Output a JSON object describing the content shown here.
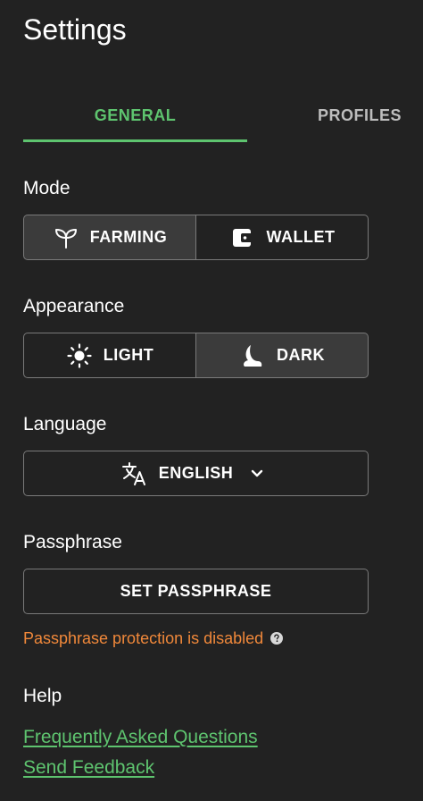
{
  "page": {
    "title": "Settings"
  },
  "tabs": [
    {
      "label": "GENERAL",
      "active": true
    },
    {
      "label": "PROFILES",
      "active": false
    }
  ],
  "mode": {
    "label": "Mode",
    "options": [
      {
        "label": "FARMING",
        "icon": "sprout-icon",
        "selected": true
      },
      {
        "label": "WALLET",
        "icon": "wallet-icon",
        "selected": false
      }
    ]
  },
  "appearance": {
    "label": "Appearance",
    "options": [
      {
        "label": "LIGHT",
        "icon": "sun-icon",
        "selected": false
      },
      {
        "label": "DARK",
        "icon": "moon-icon",
        "selected": true
      }
    ]
  },
  "language": {
    "label": "Language",
    "selected": "ENGLISH",
    "icon": "translate-icon",
    "chevron_icon": "chevron-down-icon"
  },
  "passphrase": {
    "label": "Passphrase",
    "button_label": "SET PASSPHRASE",
    "status": "Passphrase protection is disabled",
    "help_icon": "help-circle-icon"
  },
  "help": {
    "label": "Help",
    "links": [
      {
        "label": "Frequently Asked Questions"
      },
      {
        "label": "Send Feedback"
      }
    ]
  },
  "colors": {
    "background": "#222222",
    "accent": "#5ec46f",
    "warning": "#f0883a",
    "selected_segment": "#3b3b3b",
    "border": "#7a7a7a"
  }
}
